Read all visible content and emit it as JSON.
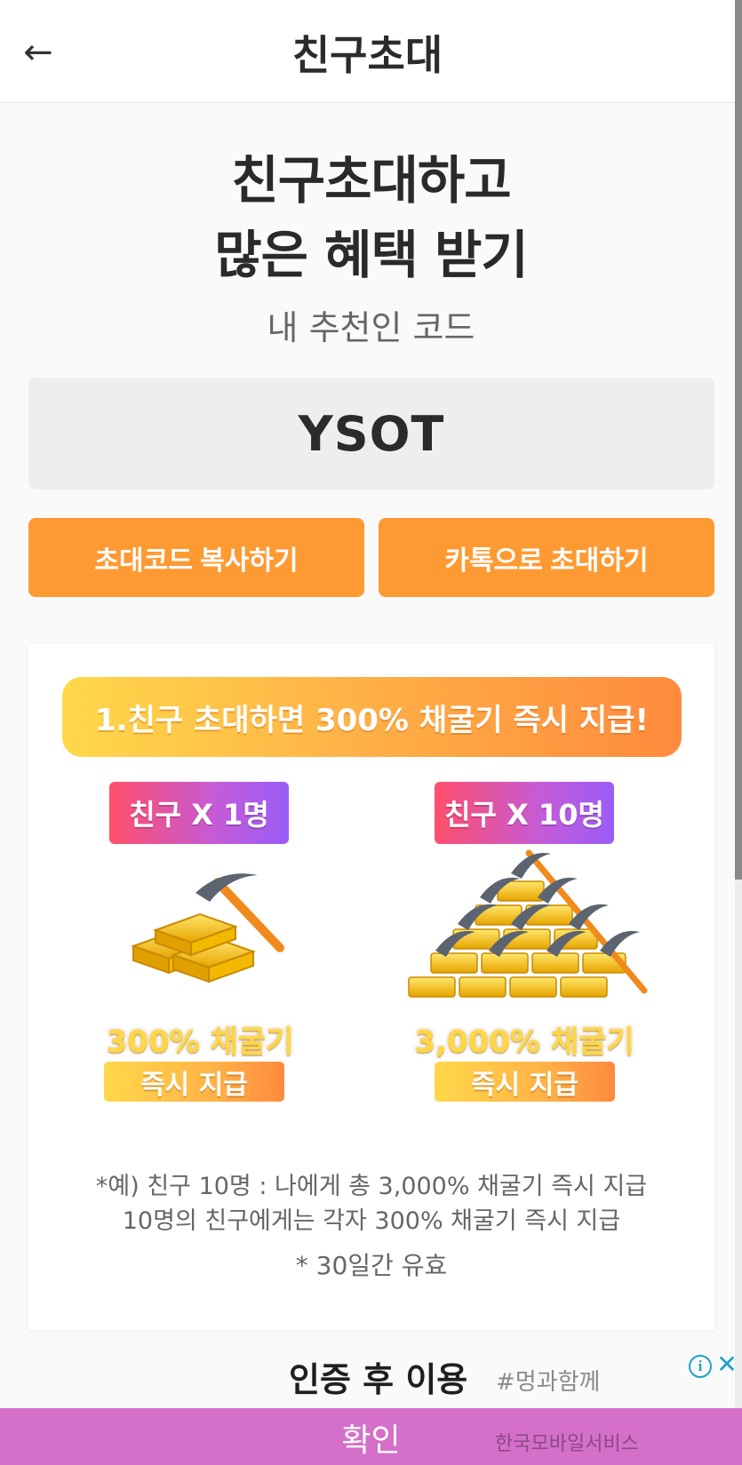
{
  "header": {
    "back_glyph": "←",
    "title": "친구초대"
  },
  "hero": {
    "line1": "친구초대하고",
    "line2": "많은 혜택 받기"
  },
  "referral": {
    "label": "내 추천인 코드",
    "code": "YSOT"
  },
  "buttons": {
    "copy_label": "초대코드 복사하기",
    "kakao_label": "카톡으로 초대하기"
  },
  "benefit_card": {
    "banner": "1.친구 초대하면 300% 채굴기 즉시 지급!",
    "tiers": [
      {
        "friends": "친구 X 1명",
        "reward": "300% 채굴기",
        "payout": "즉시 지급"
      },
      {
        "friends": "친구 X 10명",
        "reward": "3,000% 채굴기",
        "payout": "즉시 지급"
      }
    ],
    "notes": [
      "*예) 친구 10명 : 나에게 총 3,000% 채굴기 즉시 지급",
      "10명의 친구에게는 각자 300% 채굴기 즉시 지급",
      "* 30일간 유효"
    ]
  },
  "ad": {
    "title": "인증 후 이용",
    "tag": "#멍과함께",
    "info_glyph": "i",
    "close_glyph": "✕",
    "confirm_label": "확인",
    "company": "한국모바일서비스"
  },
  "colors": {
    "accent_orange": "#ff9a33",
    "ad_purple": "#d46fca",
    "gold": "#ffd646"
  }
}
